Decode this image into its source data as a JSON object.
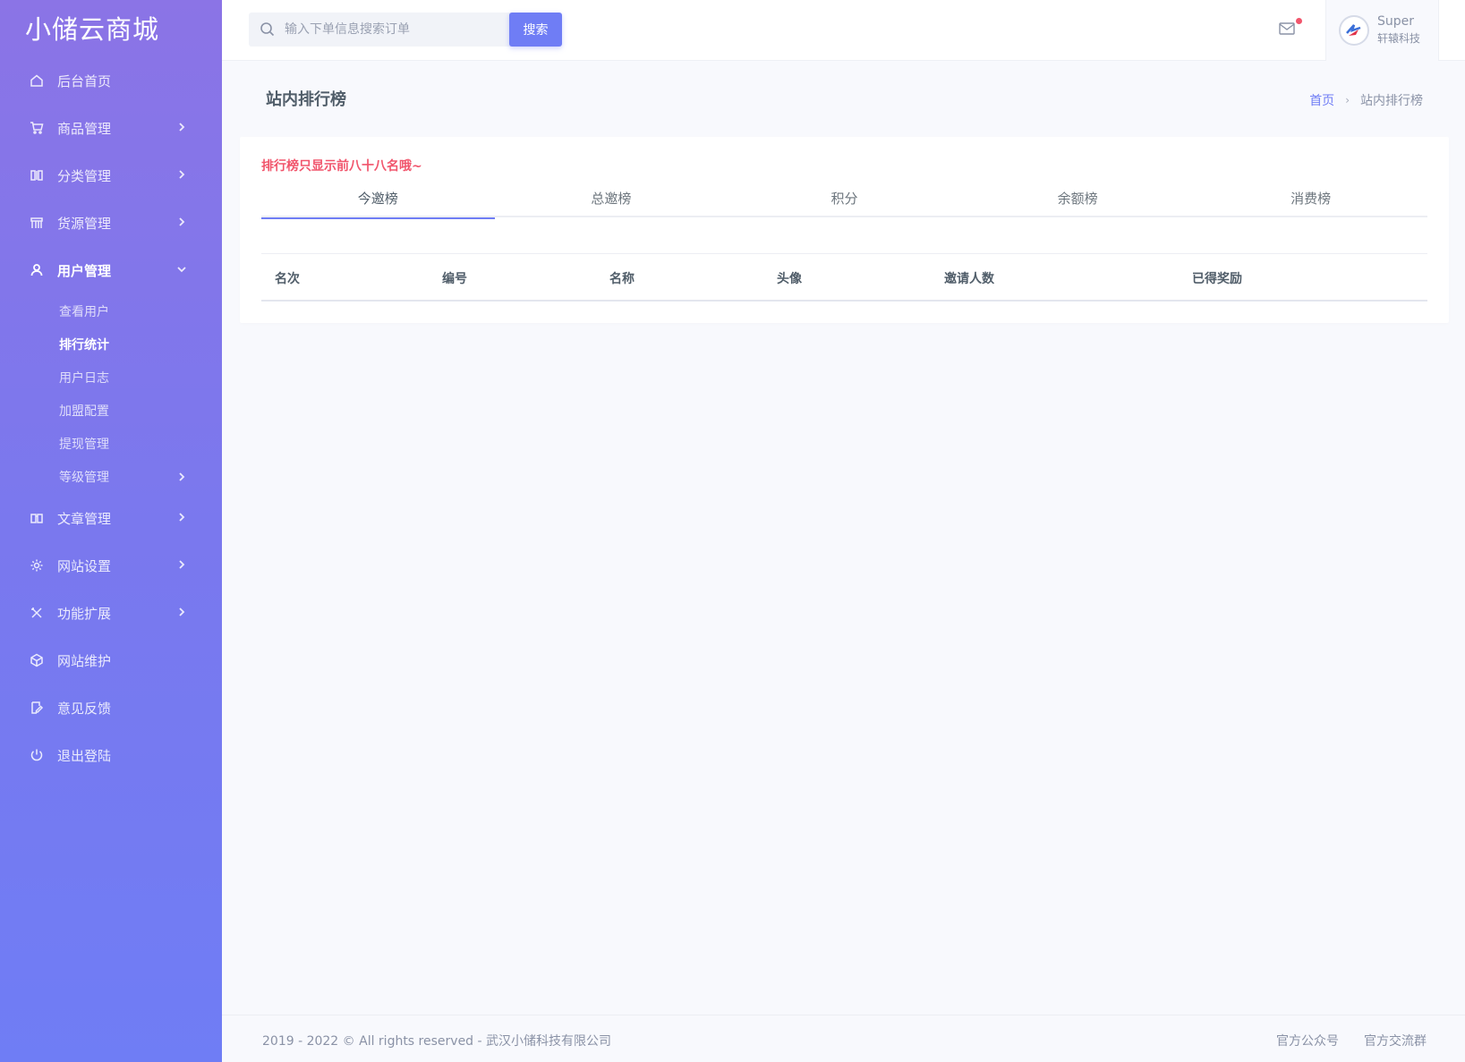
{
  "app": {
    "logo": "小储云商城"
  },
  "sidebar": {
    "items": [
      {
        "label": "后台首页"
      },
      {
        "label": "商品管理"
      },
      {
        "label": "分类管理"
      },
      {
        "label": "货源管理"
      },
      {
        "label": "用户管理"
      },
      {
        "label": "文章管理"
      },
      {
        "label": "网站设置"
      },
      {
        "label": "功能扩展"
      },
      {
        "label": "网站维护"
      },
      {
        "label": "意见反馈"
      },
      {
        "label": "退出登陆"
      }
    ],
    "sub_items": [
      {
        "label": "查看用户"
      },
      {
        "label": "排行统计"
      },
      {
        "label": "用户日志"
      },
      {
        "label": "加盟配置"
      },
      {
        "label": "提现管理"
      },
      {
        "label": "等级管理"
      }
    ]
  },
  "search": {
    "placeholder": "输入下单信息搜索订单",
    "button": "搜索"
  },
  "user": {
    "name": "Super",
    "subtitle": "轩辕科技"
  },
  "page": {
    "title": "站内排行榜"
  },
  "breadcrumb": {
    "home": "首页",
    "current": "站内排行榜"
  },
  "card": {
    "notice": "排行榜只显示前八十八名哦~",
    "tabs": [
      "今邀榜",
      "总邀榜",
      "积分",
      "余额榜",
      "消费榜"
    ],
    "columns": [
      "名次",
      "编号",
      "名称",
      "头像",
      "邀请人数",
      "已得奖励"
    ]
  },
  "footer": {
    "copyright": "2019 - 2022 © All rights reserved - 武汉小储科技有限公司",
    "links": [
      "官方公众号",
      "官方交流群"
    ]
  },
  "colors": {
    "accent": "#6f7df5",
    "notice": "#f1556c",
    "sidebar_top": "#8b74e6",
    "sidebar_bottom": "#6f7df5"
  }
}
